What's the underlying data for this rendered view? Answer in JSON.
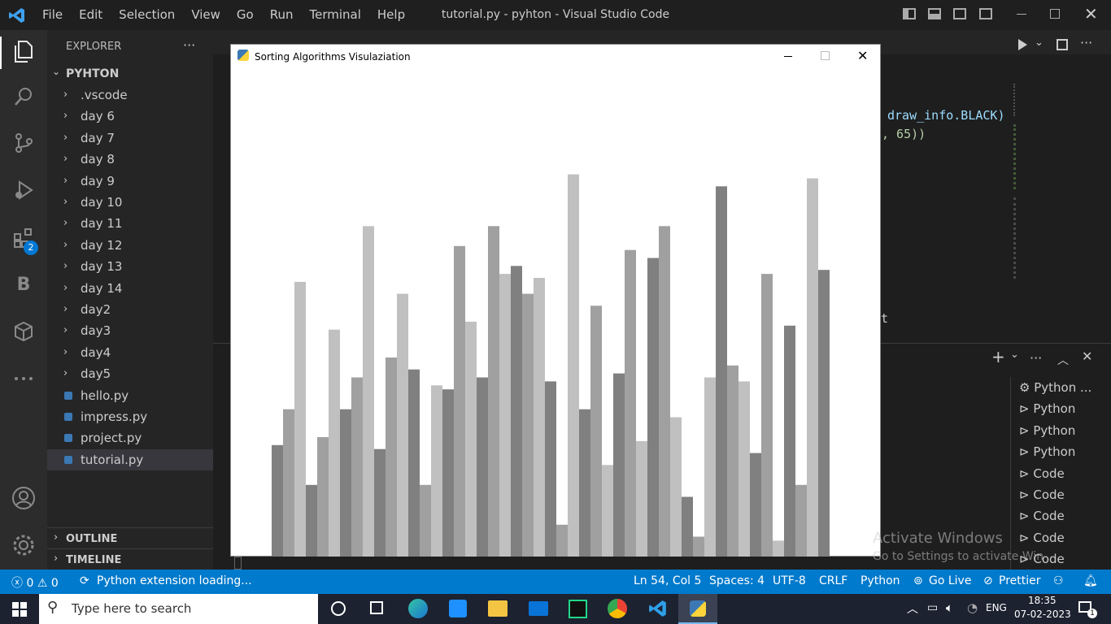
{
  "window": {
    "menus": [
      "File",
      "Edit",
      "Selection",
      "View",
      "Go",
      "Run",
      "Terminal",
      "Help"
    ],
    "title": "tutorial.py - pyhton - Visual Studio Code"
  },
  "activity": {
    "extensions_badge": "2",
    "b_label": "B"
  },
  "explorer": {
    "header": "EXPLORER",
    "more": "···",
    "root": "PYHTON",
    "items": [
      {
        "label": ".vscode",
        "type": "folder"
      },
      {
        "label": "day 6",
        "type": "folder"
      },
      {
        "label": "day 7",
        "type": "folder"
      },
      {
        "label": "day 8",
        "type": "folder"
      },
      {
        "label": "day 9",
        "type": "folder"
      },
      {
        "label": "day 10",
        "type": "folder"
      },
      {
        "label": "day 11",
        "type": "folder"
      },
      {
        "label": "day 12",
        "type": "folder"
      },
      {
        "label": "day 13",
        "type": "folder"
      },
      {
        "label": "day 14",
        "type": "folder"
      },
      {
        "label": "day2",
        "type": "folder"
      },
      {
        "label": "day3",
        "type": "folder"
      },
      {
        "label": "day4",
        "type": "folder"
      },
      {
        "label": "day5",
        "type": "folder"
      },
      {
        "label": "hello.py",
        "type": "file"
      },
      {
        "label": "impress.py",
        "type": "file"
      },
      {
        "label": "project.py",
        "type": "file"
      },
      {
        "label": "tutorial.py",
        "type": "file",
        "selected": true
      }
    ],
    "outline": "OUTLINE",
    "timeline": "TIMELINE"
  },
  "editor": {
    "code_line1": "draw_info.BLACK)",
    "code_line2": ", 65))",
    "code_stray": "t"
  },
  "terminal_list": [
    "Python ...",
    "Python",
    "Python",
    "Python",
    "Code",
    "Code",
    "Code",
    "Code",
    "Code"
  ],
  "watermark": {
    "line1": "Activate Windows",
    "line2": "Go to Settings to activate Windows."
  },
  "status": {
    "errors": "0",
    "warnings": "0",
    "loading": "Python extension loading...",
    "position": "Ln 54, Col 5",
    "spaces": "Spaces: 4",
    "encoding": "UTF-8",
    "eol": "CRLF",
    "language": "Python",
    "golive": "Go Live",
    "prettier": "Prettier"
  },
  "taskbar": {
    "search_placeholder": "Type here to search",
    "lang": "ENG",
    "time": "18:35",
    "date": "07-02-2023",
    "notif_count": "1"
  },
  "pygame": {
    "title": "Sorting Algorithms Visulaziation"
  },
  "chart_data": {
    "type": "bar",
    "colors": [
      "#808080",
      "#a0a0a0",
      "#c0c0c0"
    ],
    "values": [
      28,
      37,
      69,
      18,
      30,
      57,
      37,
      45,
      83,
      27,
      50,
      66,
      47,
      18,
      43,
      42,
      78,
      59,
      45,
      83,
      71,
      73,
      66,
      70,
      44,
      8,
      96,
      37,
      63,
      23,
      46,
      77,
      29,
      75,
      83,
      35,
      15,
      5,
      45,
      93,
      48,
      44,
      26,
      71,
      4,
      58,
      18,
      95,
      72
    ],
    "ylim": [
      0,
      100
    ]
  }
}
